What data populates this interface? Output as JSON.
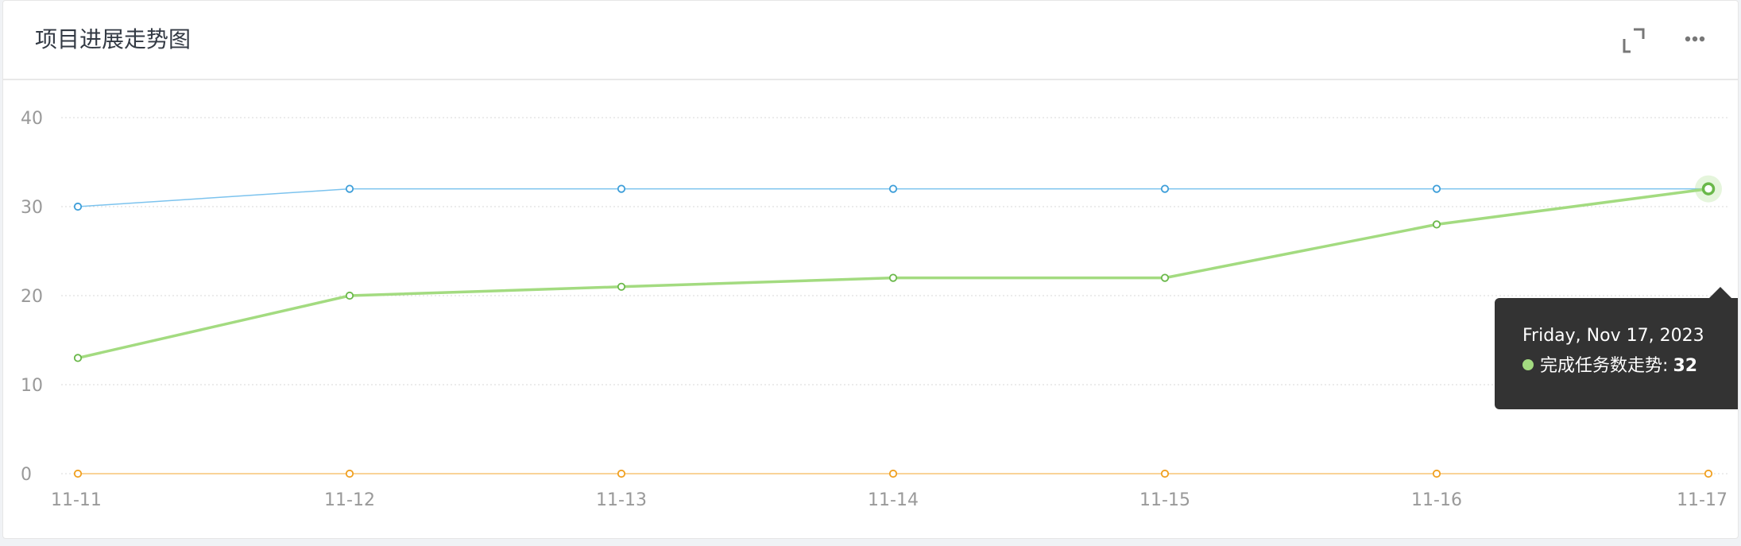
{
  "header": {
    "title": "项目进展走势图"
  },
  "icons": {
    "expand": "expand-icon",
    "more": "more-icon"
  },
  "colors": {
    "series_blue": "#7cc3ee",
    "series_green": "#a3db80",
    "series_orange": "#f5b95a",
    "blue_marker": "#3d9ed9",
    "green_marker": "#6ab84a",
    "orange_marker": "#f0a020",
    "grid": "#d9d9d9",
    "axis_text": "#999999"
  },
  "chart_data": {
    "type": "line",
    "categories": [
      "11-11",
      "11-12",
      "11-13",
      "11-14",
      "11-15",
      "11-16",
      "11-17"
    ],
    "series": [
      {
        "color": "#7cc3ee",
        "values": [
          30,
          32,
          32,
          32,
          32,
          32,
          32
        ]
      },
      {
        "name": "完成任务数走势",
        "color": "#a3db80",
        "values": [
          13,
          20,
          21,
          22,
          22,
          28,
          32
        ]
      },
      {
        "color": "#f5b95a",
        "values": [
          0,
          0,
          0,
          0,
          0,
          0,
          0
        ]
      }
    ],
    "yticks": [
      0,
      10,
      20,
      30,
      40
    ],
    "ylim": [
      0,
      40
    ],
    "grid": true,
    "tooltip": {
      "date": "Friday, Nov 17, 2023",
      "series_name": "完成任务数走势",
      "separator": ":",
      "value": "32",
      "dot_color": "#a3db80"
    }
  }
}
